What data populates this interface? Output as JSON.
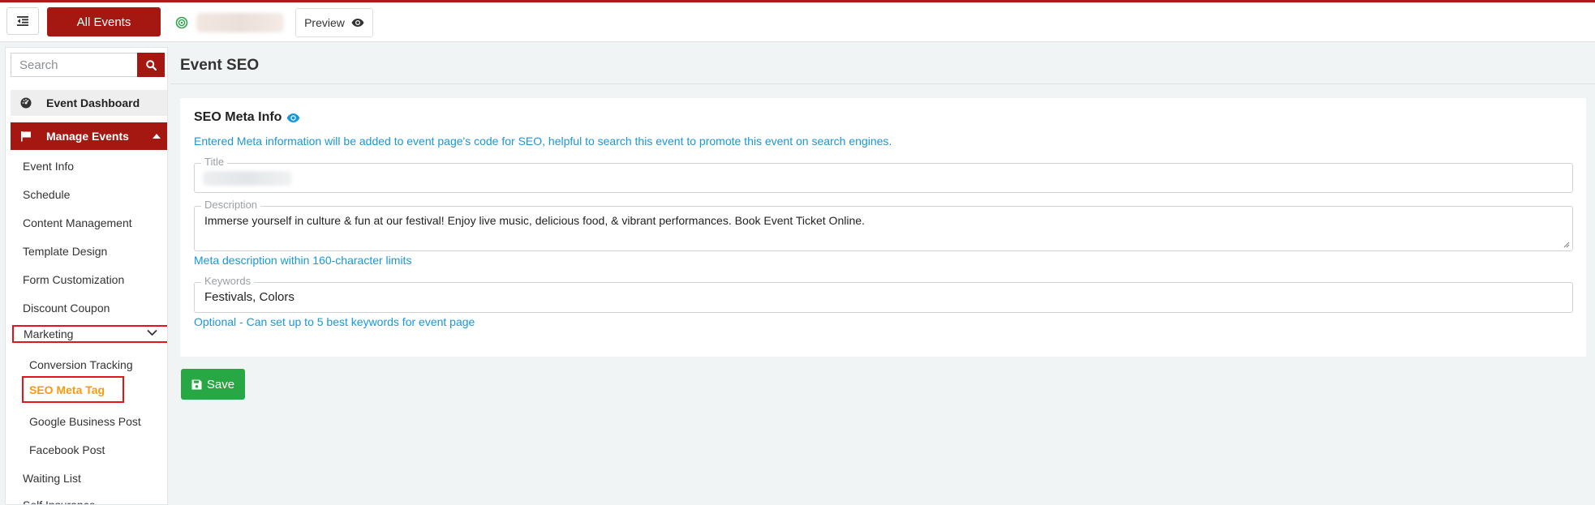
{
  "topbar": {
    "all_events_label": "All Events",
    "preview_label": "Preview",
    "accent_color": "#a51711"
  },
  "sidebar": {
    "search_placeholder": "Search",
    "dashboard_label": "Event Dashboard",
    "manage_label": "Manage Events",
    "items": [
      "Event Info",
      "Schedule",
      "Content Management",
      "Template Design",
      "Form Customization",
      "Discount Coupon"
    ],
    "marketing_label": "Marketing",
    "marketing_sub": [
      "Conversion Tracking",
      "SEO Meta Tag",
      "Google Business Post",
      "Facebook Post"
    ],
    "after_items": [
      "Waiting List",
      "Self Insurance"
    ]
  },
  "main": {
    "page_title": "Event SEO",
    "card_title": "SEO Meta Info",
    "card_note": "Entered Meta information will be added to event page's code for SEO, helpful to search this event to promote this event on search engines.",
    "title_legend": "Title",
    "description_legend": "Description",
    "description_value": "Immerse yourself in culture & fun at our festival! Enjoy live music, delicious food, & vibrant performances. Book Event Ticket Online.",
    "description_help": "Meta description within 160-character limits",
    "keywords_legend": "Keywords",
    "keywords_value": "Festivals, Colors",
    "keywords_help": "Optional - Can set up to 5 best keywords for event page",
    "save_label": "Save"
  }
}
